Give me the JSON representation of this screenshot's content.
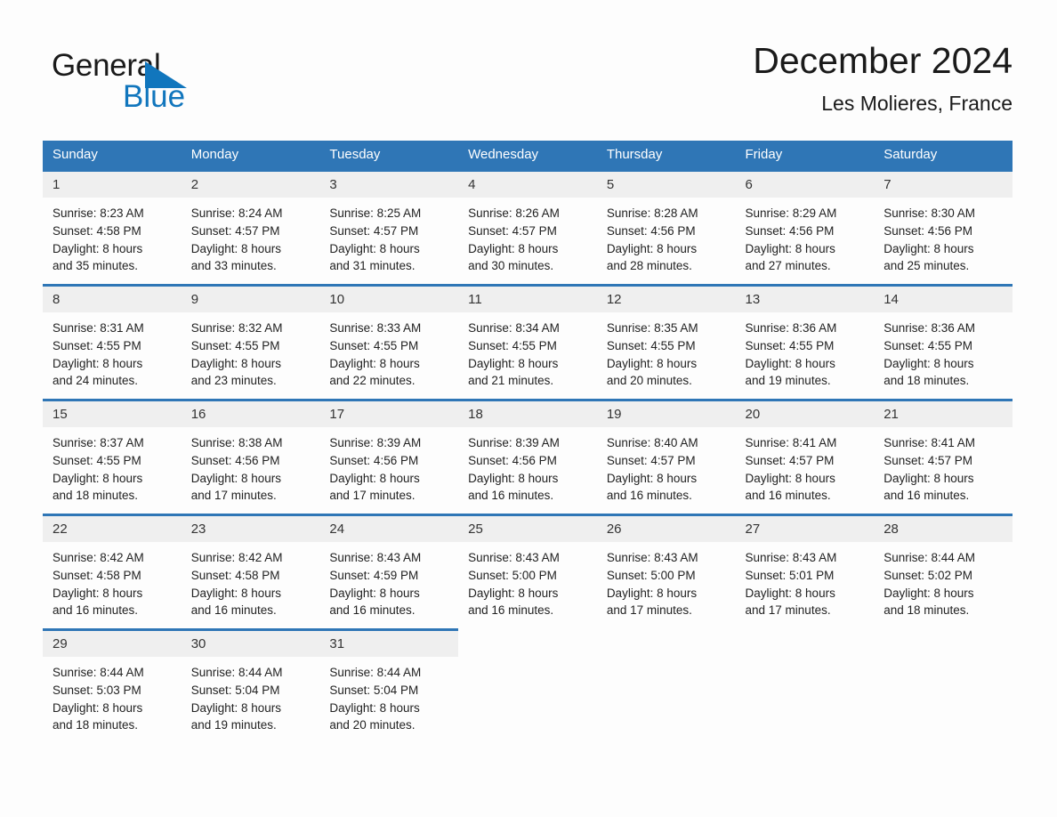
{
  "brand": {
    "name_part1": "General",
    "name_part2": "Blue",
    "triangle_icon": "triangle-icon",
    "accent_color": "#1176bd"
  },
  "header": {
    "title": "December 2024",
    "subtitle": "Les Molieres, France"
  },
  "theme": {
    "header_blue": "#2f76b6",
    "date_strip_gray": "#efefef",
    "page_background": "#fdfdfd",
    "text_color": "#222222"
  },
  "calendar": {
    "weekday_headers": [
      "Sunday",
      "Monday",
      "Tuesday",
      "Wednesday",
      "Thursday",
      "Friday",
      "Saturday"
    ],
    "labels": {
      "sunrise": "Sunrise:",
      "sunset": "Sunset:",
      "daylight": "Daylight:"
    },
    "weeks": [
      [
        {
          "day": "1",
          "sunrise": "Sunrise: 8:23 AM",
          "sunset": "Sunset: 4:58 PM",
          "daylight_line1": "Daylight: 8 hours",
          "daylight_line2": "and 35 minutes."
        },
        {
          "day": "2",
          "sunrise": "Sunrise: 8:24 AM",
          "sunset": "Sunset: 4:57 PM",
          "daylight_line1": "Daylight: 8 hours",
          "daylight_line2": "and 33 minutes."
        },
        {
          "day": "3",
          "sunrise": "Sunrise: 8:25 AM",
          "sunset": "Sunset: 4:57 PM",
          "daylight_line1": "Daylight: 8 hours",
          "daylight_line2": "and 31 minutes."
        },
        {
          "day": "4",
          "sunrise": "Sunrise: 8:26 AM",
          "sunset": "Sunset: 4:57 PM",
          "daylight_line1": "Daylight: 8 hours",
          "daylight_line2": "and 30 minutes."
        },
        {
          "day": "5",
          "sunrise": "Sunrise: 8:28 AM",
          "sunset": "Sunset: 4:56 PM",
          "daylight_line1": "Daylight: 8 hours",
          "daylight_line2": "and 28 minutes."
        },
        {
          "day": "6",
          "sunrise": "Sunrise: 8:29 AM",
          "sunset": "Sunset: 4:56 PM",
          "daylight_line1": "Daylight: 8 hours",
          "daylight_line2": "and 27 minutes."
        },
        {
          "day": "7",
          "sunrise": "Sunrise: 8:30 AM",
          "sunset": "Sunset: 4:56 PM",
          "daylight_line1": "Daylight: 8 hours",
          "daylight_line2": "and 25 minutes."
        }
      ],
      [
        {
          "day": "8",
          "sunrise": "Sunrise: 8:31 AM",
          "sunset": "Sunset: 4:55 PM",
          "daylight_line1": "Daylight: 8 hours",
          "daylight_line2": "and 24 minutes."
        },
        {
          "day": "9",
          "sunrise": "Sunrise: 8:32 AM",
          "sunset": "Sunset: 4:55 PM",
          "daylight_line1": "Daylight: 8 hours",
          "daylight_line2": "and 23 minutes."
        },
        {
          "day": "10",
          "sunrise": "Sunrise: 8:33 AM",
          "sunset": "Sunset: 4:55 PM",
          "daylight_line1": "Daylight: 8 hours",
          "daylight_line2": "and 22 minutes."
        },
        {
          "day": "11",
          "sunrise": "Sunrise: 8:34 AM",
          "sunset": "Sunset: 4:55 PM",
          "daylight_line1": "Daylight: 8 hours",
          "daylight_line2": "and 21 minutes."
        },
        {
          "day": "12",
          "sunrise": "Sunrise: 8:35 AM",
          "sunset": "Sunset: 4:55 PM",
          "daylight_line1": "Daylight: 8 hours",
          "daylight_line2": "and 20 minutes."
        },
        {
          "day": "13",
          "sunrise": "Sunrise: 8:36 AM",
          "sunset": "Sunset: 4:55 PM",
          "daylight_line1": "Daylight: 8 hours",
          "daylight_line2": "and 19 minutes."
        },
        {
          "day": "14",
          "sunrise": "Sunrise: 8:36 AM",
          "sunset": "Sunset: 4:55 PM",
          "daylight_line1": "Daylight: 8 hours",
          "daylight_line2": "and 18 minutes."
        }
      ],
      [
        {
          "day": "15",
          "sunrise": "Sunrise: 8:37 AM",
          "sunset": "Sunset: 4:55 PM",
          "daylight_line1": "Daylight: 8 hours",
          "daylight_line2": "and 18 minutes."
        },
        {
          "day": "16",
          "sunrise": "Sunrise: 8:38 AM",
          "sunset": "Sunset: 4:56 PM",
          "daylight_line1": "Daylight: 8 hours",
          "daylight_line2": "and 17 minutes."
        },
        {
          "day": "17",
          "sunrise": "Sunrise: 8:39 AM",
          "sunset": "Sunset: 4:56 PM",
          "daylight_line1": "Daylight: 8 hours",
          "daylight_line2": "and 17 minutes."
        },
        {
          "day": "18",
          "sunrise": "Sunrise: 8:39 AM",
          "sunset": "Sunset: 4:56 PM",
          "daylight_line1": "Daylight: 8 hours",
          "daylight_line2": "and 16 minutes."
        },
        {
          "day": "19",
          "sunrise": "Sunrise: 8:40 AM",
          "sunset": "Sunset: 4:57 PM",
          "daylight_line1": "Daylight: 8 hours",
          "daylight_line2": "and 16 minutes."
        },
        {
          "day": "20",
          "sunrise": "Sunrise: 8:41 AM",
          "sunset": "Sunset: 4:57 PM",
          "daylight_line1": "Daylight: 8 hours",
          "daylight_line2": "and 16 minutes."
        },
        {
          "day": "21",
          "sunrise": "Sunrise: 8:41 AM",
          "sunset": "Sunset: 4:57 PM",
          "daylight_line1": "Daylight: 8 hours",
          "daylight_line2": "and 16 minutes."
        }
      ],
      [
        {
          "day": "22",
          "sunrise": "Sunrise: 8:42 AM",
          "sunset": "Sunset: 4:58 PM",
          "daylight_line1": "Daylight: 8 hours",
          "daylight_line2": "and 16 minutes."
        },
        {
          "day": "23",
          "sunrise": "Sunrise: 8:42 AM",
          "sunset": "Sunset: 4:58 PM",
          "daylight_line1": "Daylight: 8 hours",
          "daylight_line2": "and 16 minutes."
        },
        {
          "day": "24",
          "sunrise": "Sunrise: 8:43 AM",
          "sunset": "Sunset: 4:59 PM",
          "daylight_line1": "Daylight: 8 hours",
          "daylight_line2": "and 16 minutes."
        },
        {
          "day": "25",
          "sunrise": "Sunrise: 8:43 AM",
          "sunset": "Sunset: 5:00 PM",
          "daylight_line1": "Daylight: 8 hours",
          "daylight_line2": "and 16 minutes."
        },
        {
          "day": "26",
          "sunrise": "Sunrise: 8:43 AM",
          "sunset": "Sunset: 5:00 PM",
          "daylight_line1": "Daylight: 8 hours",
          "daylight_line2": "and 17 minutes."
        },
        {
          "day": "27",
          "sunrise": "Sunrise: 8:43 AM",
          "sunset": "Sunset: 5:01 PM",
          "daylight_line1": "Daylight: 8 hours",
          "daylight_line2": "and 17 minutes."
        },
        {
          "day": "28",
          "sunrise": "Sunrise: 8:44 AM",
          "sunset": "Sunset: 5:02 PM",
          "daylight_line1": "Daylight: 8 hours",
          "daylight_line2": "and 18 minutes."
        }
      ],
      [
        {
          "day": "29",
          "sunrise": "Sunrise: 8:44 AM",
          "sunset": "Sunset: 5:03 PM",
          "daylight_line1": "Daylight: 8 hours",
          "daylight_line2": "and 18 minutes."
        },
        {
          "day": "30",
          "sunrise": "Sunrise: 8:44 AM",
          "sunset": "Sunset: 5:04 PM",
          "daylight_line1": "Daylight: 8 hours",
          "daylight_line2": "and 19 minutes."
        },
        {
          "day": "31",
          "sunrise": "Sunrise: 8:44 AM",
          "sunset": "Sunset: 5:04 PM",
          "daylight_line1": "Daylight: 8 hours",
          "daylight_line2": "and 20 minutes."
        },
        {
          "day": "",
          "sunrise": "",
          "sunset": "",
          "daylight_line1": "",
          "daylight_line2": ""
        },
        {
          "day": "",
          "sunrise": "",
          "sunset": "",
          "daylight_line1": "",
          "daylight_line2": ""
        },
        {
          "day": "",
          "sunrise": "",
          "sunset": "",
          "daylight_line1": "",
          "daylight_line2": ""
        },
        {
          "day": "",
          "sunrise": "",
          "sunset": "",
          "daylight_line1": "",
          "daylight_line2": ""
        }
      ]
    ]
  }
}
